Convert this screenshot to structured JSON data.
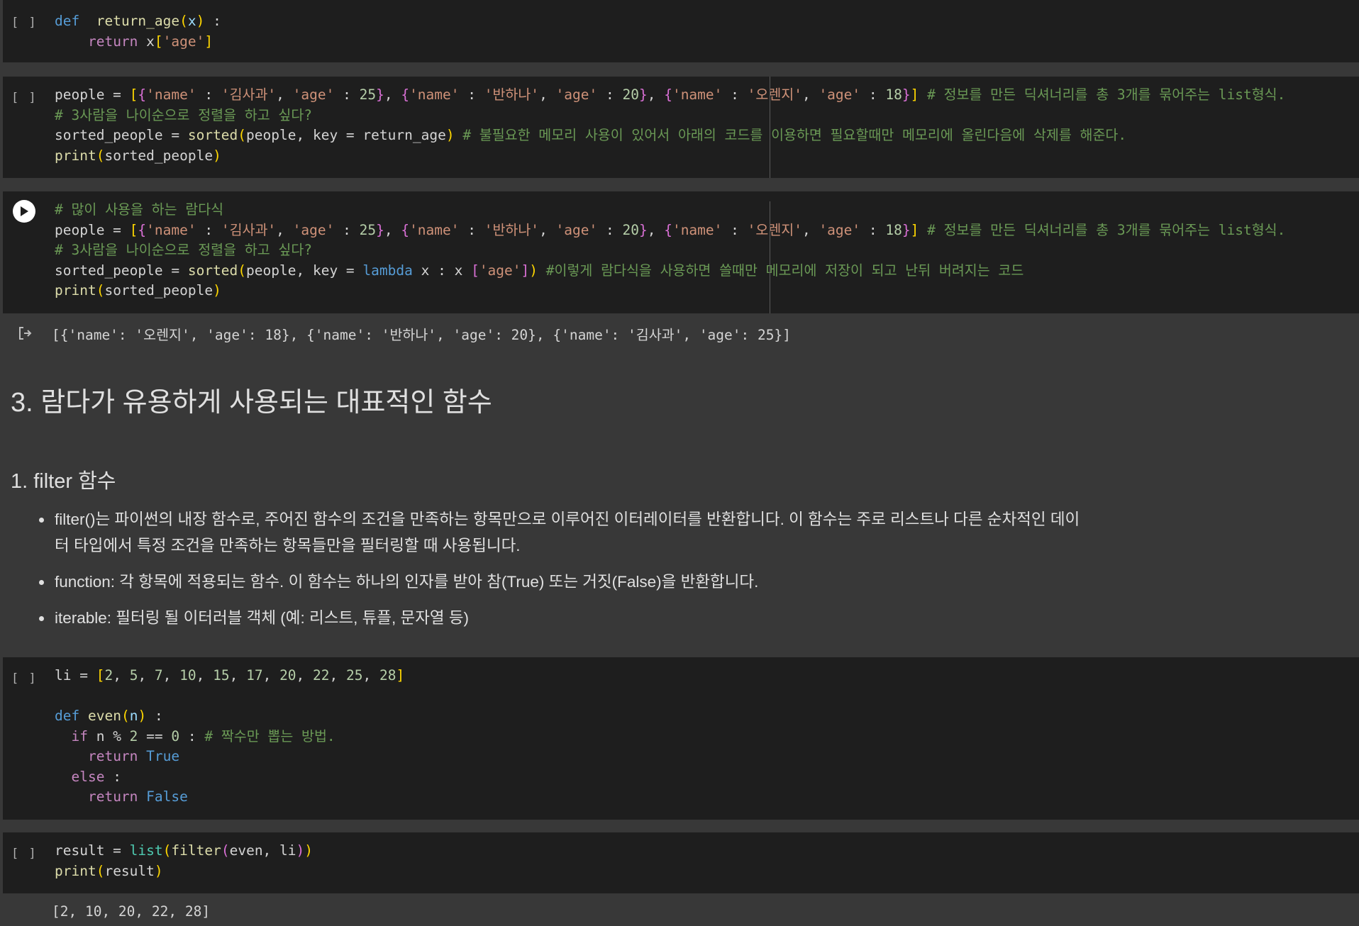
{
  "gutter_label": "[ ]",
  "cells": {
    "c1": {
      "lines": [
        [
          [
            "kw",
            "def"
          ],
          [
            "",
            "  "
          ],
          [
            "fn",
            "return_age"
          ],
          [
            "b1",
            "("
          ],
          [
            "var",
            "x"
          ],
          [
            "b1",
            ")"
          ],
          [
            "",
            " :"
          ]
        ],
        [
          [
            "",
            "    "
          ],
          [
            "ctl",
            "return"
          ],
          [
            "",
            " x"
          ],
          [
            "b1",
            "["
          ],
          [
            "str",
            "'age'"
          ],
          [
            "b1",
            "]"
          ]
        ]
      ]
    },
    "c2": {
      "lines": [
        [
          [
            "",
            "people = "
          ],
          [
            "b1",
            "["
          ],
          [
            "b2",
            "{"
          ],
          [
            "str",
            "'name'"
          ],
          [
            "",
            " : "
          ],
          [
            "str",
            "'김사과'"
          ],
          [
            "",
            ", "
          ],
          [
            "str",
            "'age'"
          ],
          [
            "",
            " : "
          ],
          [
            "num",
            "25"
          ],
          [
            "b2",
            "}"
          ],
          [
            "",
            ", "
          ],
          [
            "b2",
            "{"
          ],
          [
            "str",
            "'name'"
          ],
          [
            "",
            " : "
          ],
          [
            "str",
            "'반하나'"
          ],
          [
            "",
            ", "
          ],
          [
            "str",
            "'age'"
          ],
          [
            "",
            " : "
          ],
          [
            "num",
            "20"
          ],
          [
            "b2",
            "}"
          ],
          [
            "",
            ", "
          ],
          [
            "b2",
            "{"
          ],
          [
            "str",
            "'name'"
          ],
          [
            "",
            " : "
          ],
          [
            "str",
            "'오렌지'"
          ],
          [
            "",
            ", "
          ],
          [
            "str",
            "'age'"
          ],
          [
            "",
            " : "
          ],
          [
            "num",
            "18"
          ],
          [
            "b2",
            "}"
          ],
          [
            "b1",
            "]"
          ],
          [
            "",
            " "
          ],
          [
            "cm",
            "# 정보를 만든 딕셔너리를 총 3개를 묶어주는 list형식."
          ]
        ],
        [
          [
            "cm",
            "# 3사람을 나이순으로 정렬을 하고 싶다?"
          ]
        ],
        [
          [
            "",
            "sorted_people = "
          ],
          [
            "fn",
            "sorted"
          ],
          [
            "b1",
            "("
          ],
          [
            "",
            "people, key = return_age"
          ],
          [
            "b1",
            ")"
          ],
          [
            "",
            " "
          ],
          [
            "cm",
            "# 불필요한 메모리 사용이 있어서 아래의 코드를 이용하면 필요할때만 메모리에 올린다음에 삭제를 해준다."
          ]
        ],
        [
          [
            "fn",
            "print"
          ],
          [
            "b1",
            "("
          ],
          [
            "",
            "sorted_people"
          ],
          [
            "b1",
            ")"
          ]
        ]
      ]
    },
    "c3": {
      "lines": [
        [
          [
            "cm",
            "# 많이 사용을 하는 람다식"
          ]
        ],
        [
          [
            "",
            "people = "
          ],
          [
            "b1",
            "["
          ],
          [
            "b2",
            "{"
          ],
          [
            "str",
            "'name'"
          ],
          [
            "",
            " : "
          ],
          [
            "str",
            "'김사과'"
          ],
          [
            "",
            ", "
          ],
          [
            "str",
            "'age'"
          ],
          [
            "",
            " : "
          ],
          [
            "num",
            "25"
          ],
          [
            "b2",
            "}"
          ],
          [
            "",
            ", "
          ],
          [
            "b2",
            "{"
          ],
          [
            "str",
            "'name'"
          ],
          [
            "",
            " : "
          ],
          [
            "str",
            "'반하나'"
          ],
          [
            "",
            ", "
          ],
          [
            "str",
            "'age'"
          ],
          [
            "",
            " : "
          ],
          [
            "num",
            "20"
          ],
          [
            "b2",
            "}"
          ],
          [
            "",
            ", "
          ],
          [
            "b2",
            "{"
          ],
          [
            "str",
            "'name'"
          ],
          [
            "",
            " : "
          ],
          [
            "str",
            "'오렌지'"
          ],
          [
            "",
            ", "
          ],
          [
            "str",
            "'age'"
          ],
          [
            "",
            " : "
          ],
          [
            "num",
            "18"
          ],
          [
            "b2",
            "}"
          ],
          [
            "b1",
            "]"
          ],
          [
            "",
            " "
          ],
          [
            "cm",
            "# 정보를 만든 딕셔너리를 총 3개를 묶어주는 list형식."
          ]
        ],
        [
          [
            "cm",
            "# 3사람을 나이순으로 정렬을 하고 싶다?"
          ]
        ],
        [
          [
            "",
            "sorted_people = "
          ],
          [
            "fn",
            "sorted"
          ],
          [
            "b1",
            "("
          ],
          [
            "",
            "people, key = "
          ],
          [
            "kw",
            "lambda"
          ],
          [
            "",
            " x : x "
          ],
          [
            "b2",
            "["
          ],
          [
            "str",
            "'age'"
          ],
          [
            "b2",
            "]"
          ],
          [
            "b1",
            ")"
          ],
          [
            "",
            " "
          ],
          [
            "cm",
            "#이렇게 람다식을 사용하면 쓸때만 메모리에 저장이 되고 난뒤 버려지는 코드"
          ]
        ],
        [
          [
            "fn",
            "print"
          ],
          [
            "b1",
            "("
          ],
          [
            "",
            "sorted_people"
          ],
          [
            "b1",
            ")"
          ]
        ]
      ],
      "output": "[{'name': '오렌지', 'age': 18}, {'name': '반하나', 'age': 20}, {'name': '김사과', 'age': 25}]"
    },
    "c4": {
      "lines": [
        [
          [
            "",
            "li = "
          ],
          [
            "b1",
            "["
          ],
          [
            "num",
            "2"
          ],
          [
            "",
            ", "
          ],
          [
            "num",
            "5"
          ],
          [
            "",
            ", "
          ],
          [
            "num",
            "7"
          ],
          [
            "",
            ", "
          ],
          [
            "num",
            "10"
          ],
          [
            "",
            ", "
          ],
          [
            "num",
            "15"
          ],
          [
            "",
            ", "
          ],
          [
            "num",
            "17"
          ],
          [
            "",
            ", "
          ],
          [
            "num",
            "20"
          ],
          [
            "",
            ", "
          ],
          [
            "num",
            "22"
          ],
          [
            "",
            ", "
          ],
          [
            "num",
            "25"
          ],
          [
            "",
            ", "
          ],
          [
            "num",
            "28"
          ],
          [
            "b1",
            "]"
          ]
        ],
        [
          [
            "",
            ""
          ]
        ],
        [
          [
            "kw",
            "def"
          ],
          [
            "",
            " "
          ],
          [
            "fn",
            "even"
          ],
          [
            "b1",
            "("
          ],
          [
            "var",
            "n"
          ],
          [
            "b1",
            ")"
          ],
          [
            "",
            " :"
          ]
        ],
        [
          [
            "",
            "  "
          ],
          [
            "ctl",
            "if"
          ],
          [
            "",
            " n % "
          ],
          [
            "num",
            "2"
          ],
          [
            "",
            " == "
          ],
          [
            "num",
            "0"
          ],
          [
            "",
            " : "
          ],
          [
            "cm",
            "# 짝수만 뽑는 방법."
          ]
        ],
        [
          [
            "",
            "    "
          ],
          [
            "ctl",
            "return"
          ],
          [
            "",
            " "
          ],
          [
            "kw",
            "True"
          ]
        ],
        [
          [
            "",
            "  "
          ],
          [
            "ctl",
            "else"
          ],
          [
            "",
            " :"
          ]
        ],
        [
          [
            "",
            "    "
          ],
          [
            "ctl",
            "return"
          ],
          [
            "",
            " "
          ],
          [
            "kw",
            "False"
          ]
        ]
      ]
    },
    "c5": {
      "lines": [
        [
          [
            "",
            "result = "
          ],
          [
            "bi",
            "list"
          ],
          [
            "b1",
            "("
          ],
          [
            "fn",
            "filter"
          ],
          [
            "b2",
            "("
          ],
          [
            "",
            "even, li"
          ],
          [
            "b2",
            ")"
          ],
          [
            "b1",
            ")"
          ]
        ],
        [
          [
            "fn",
            "print"
          ],
          [
            "b1",
            "("
          ],
          [
            "",
            "result"
          ],
          [
            "b1",
            ")"
          ]
        ]
      ],
      "output": "[2, 10, 20, 22, 28]"
    }
  },
  "markdown": {
    "heading": "3. 람다가 유용하게 사용되는 대표적인 함수",
    "subheading": "1. filter 함수",
    "bullets": [
      "filter()는 파이썬의 내장 함수로, 주어진 함수의 조건을 만족하는 항목만으로 이루어진 이터레이터를 반환합니다. 이 함수는 주로 리스트나 다른 순차적인 데이터 타입에서 특정 조건을 만족하는 항목들만을 필터링할 때 사용됩니다.",
      "function: 각 항목에 적용되는 함수. 이 함수는 하나의 인자를 받아 참(True) 또는 거짓(False)을 반환합니다.",
      "iterable: 필터링 될 이터러블 객체 (예: 리스트, 튜플, 문자열 등)"
    ]
  }
}
